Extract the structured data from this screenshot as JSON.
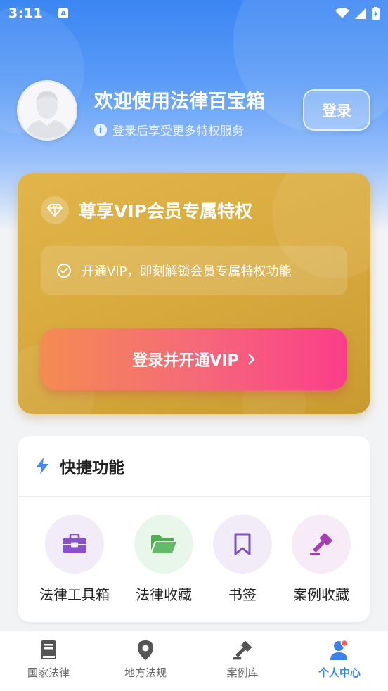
{
  "status_bar": {
    "time": "3:11",
    "notification_glyph": "A"
  },
  "profile": {
    "welcome_title": "欢迎使用法律百宝箱",
    "subtitle": "登录后享受更多特权服务",
    "login_label": "登录"
  },
  "vip": {
    "title": "尊享VIP会员专属特权",
    "benefit": "开通VIP，即刻解锁会员专属特权功能",
    "cta_label": "登录并开通VIP",
    "colors": {
      "card": "#d8aa3e",
      "cta_start": "#f58b52",
      "cta_end": "#fb3d8a"
    }
  },
  "quick": {
    "title": "快捷功能",
    "items": [
      {
        "label": "法律工具箱",
        "icon": "toolbox-icon",
        "bg": "#f1ecf8",
        "color": "#8a52c9"
      },
      {
        "label": "法律收藏",
        "icon": "folder-icon",
        "bg": "#e9f6ea",
        "color": "#4cb050"
      },
      {
        "label": "书签",
        "icon": "bookmark-icon",
        "bg": "#f1ecf8",
        "color": "#7c4fc4"
      },
      {
        "label": "案例收藏",
        "icon": "gavel-icon",
        "bg": "#f6ebf6",
        "color": "#a33fb0"
      }
    ]
  },
  "bottom_nav": {
    "items": [
      {
        "label": "国家法律",
        "icon": "book-icon",
        "active": false
      },
      {
        "label": "地方法规",
        "icon": "location-pin-icon",
        "active": false
      },
      {
        "label": "案例库",
        "icon": "gavel-icon",
        "active": false
      },
      {
        "label": "个人中心",
        "icon": "person-icon",
        "active": true
      }
    ],
    "active_color": "#3b82f0"
  }
}
